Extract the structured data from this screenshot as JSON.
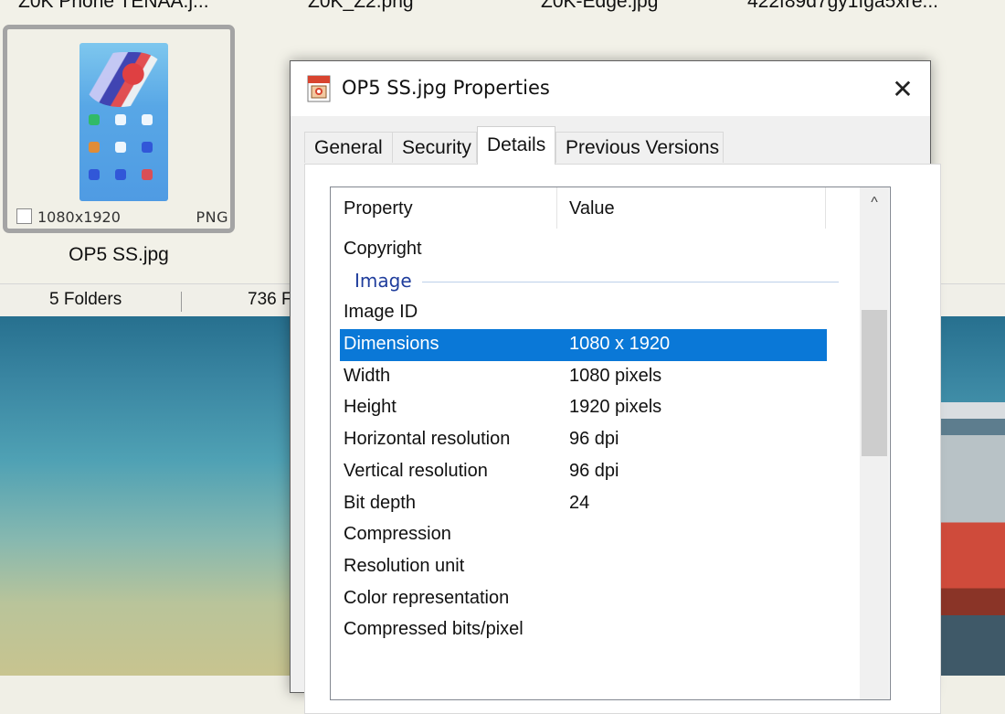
{
  "explorer": {
    "top_filenames": [
      "Z0K Phone TENAA.j...",
      "Z0K_Z2.png",
      "Z0K-Edge.jpg",
      "422f89d7gy1fga5xre..."
    ],
    "selected_thumb": {
      "dimensions": "1080x1920",
      "format": "PNG",
      "name": "OP5 SS.jpg"
    },
    "status": {
      "folders": "5 Folders",
      "files": "736 F"
    }
  },
  "dialog": {
    "title": "OP5 SS.jpg Properties",
    "close_glyph": "✕",
    "tabs": [
      {
        "label": "General",
        "active": false
      },
      {
        "label": "Security",
        "active": false
      },
      {
        "label": "Details",
        "active": true
      },
      {
        "label": "Previous Versions",
        "active": false
      }
    ],
    "columns": {
      "property": "Property",
      "value": "Value"
    },
    "rows_before_group": [
      {
        "property": "Copyright",
        "value": ""
      }
    ],
    "group": "Image",
    "rows": [
      {
        "property": "Image ID",
        "value": ""
      },
      {
        "property": "Dimensions",
        "value": "1080 x 1920",
        "selected": true
      },
      {
        "property": "Width",
        "value": "1080 pixels"
      },
      {
        "property": "Height",
        "value": "1920 pixels"
      },
      {
        "property": "Horizontal resolution",
        "value": "96 dpi"
      },
      {
        "property": "Vertical resolution",
        "value": "96 dpi"
      },
      {
        "property": "Bit depth",
        "value": "24"
      },
      {
        "property": "Compression",
        "value": ""
      },
      {
        "property": "Resolution unit",
        "value": ""
      },
      {
        "property": "Color representation",
        "value": ""
      },
      {
        "property": "Compressed bits/pixel",
        "value": ""
      }
    ],
    "scroll_up_glyph": "^",
    "selection_color": "#0a78d7"
  }
}
